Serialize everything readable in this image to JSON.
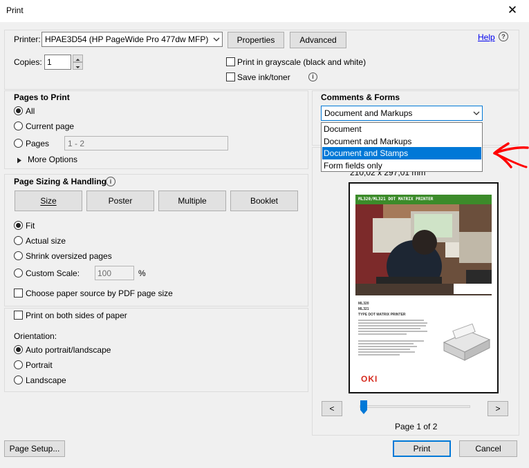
{
  "window": {
    "title": "Print",
    "close_glyph": "✕"
  },
  "printer": {
    "label": "Printer:",
    "selected": "HPAE3D54 (HP PageWide Pro 477dw MFP)",
    "properties_label": "Properties",
    "advanced_label": "Advanced",
    "help_label": "Help",
    "help_icon_glyph": "?",
    "copies_label": "Copies:",
    "copies_value": "1",
    "grayscale_label": "Print in grayscale (black and white)",
    "save_ink_label": "Save ink/toner",
    "info_glyph": "i"
  },
  "pages_to_print": {
    "heading": "Pages to Print",
    "all_label": "All",
    "current_page_label": "Current page",
    "pages_label": "Pages",
    "pages_value": "1 - 2",
    "more_options_label": "More Options"
  },
  "sizing": {
    "heading": "Page Sizing & Handling",
    "tab_size": "Size",
    "tab_poster": "Poster",
    "tab_multiple": "Multiple",
    "tab_booklet": "Booklet",
    "fit_label": "Fit",
    "actual_size_label": "Actual size",
    "shrink_label": "Shrink oversized pages",
    "custom_scale_label": "Custom Scale:",
    "custom_scale_value": "100",
    "percent_label": "%",
    "paper_source_label": "Choose paper source by PDF page size"
  },
  "duplex": {
    "both_sides_label": "Print on both sides of paper",
    "orientation_label": "Orientation:",
    "auto_label": "Auto portrait/landscape",
    "portrait_label": "Portrait",
    "landscape_label": "Landscape"
  },
  "comments_forms": {
    "heading": "Comments & Forms",
    "selected": "Document and Markups",
    "options": [
      "Document",
      "Document and Markups",
      "Document and Stamps",
      "Form fields only"
    ],
    "highlighted_index": 2,
    "page_size_text": "210,02 x 297,01 mm"
  },
  "preview": {
    "doc_header": "ML320/ML321 DOT MATRIX PRINTER",
    "bullet_1": "ML320",
    "bullet_2": "ML321",
    "bullet_3": "TYPE DOT MATRIX PRINTER",
    "brand": "OKI",
    "prev_label": "<",
    "next_label": ">",
    "page_indicator": "Page 1 of 2",
    "slider_position": 0.04
  },
  "footer": {
    "page_setup_label": "Page Setup...",
    "print_label": "Print",
    "cancel_label": "Cancel"
  },
  "colors": {
    "accent": "#0078d7",
    "annotation_red": "#ff0000",
    "brand_red": "#d62b1f"
  }
}
